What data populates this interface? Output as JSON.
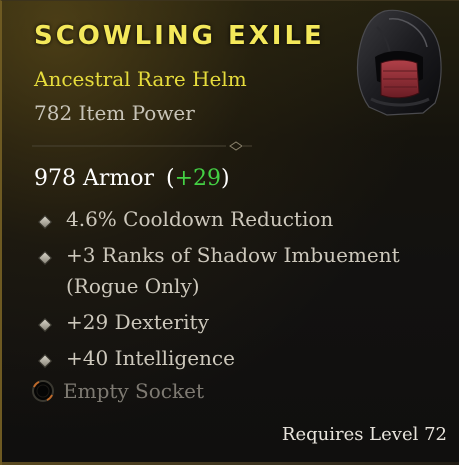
{
  "item": {
    "name": "SCOWLING EXILE",
    "type": "Ancestral Rare Helm",
    "item_power": "782 Item Power",
    "armor": {
      "value": "978 Armor",
      "open_paren": "(",
      "delta": "+29",
      "close_paren": ")"
    },
    "affixes": [
      "4.6% Cooldown Reduction",
      "+3 Ranks of Shadow Imbuement (Rogue Only)",
      "+29 Dexterity",
      "+40 Intelligence"
    ],
    "socket": "Empty Socket",
    "requirement": "Requires Level 72",
    "icon": "hooded-helm-icon"
  },
  "colors": {
    "name": "#f4e85a",
    "type": "#e6dc3c",
    "positive_delta": "#44d044",
    "affix_text": "#cdc8bc",
    "socket_text": "#7e7a72"
  }
}
